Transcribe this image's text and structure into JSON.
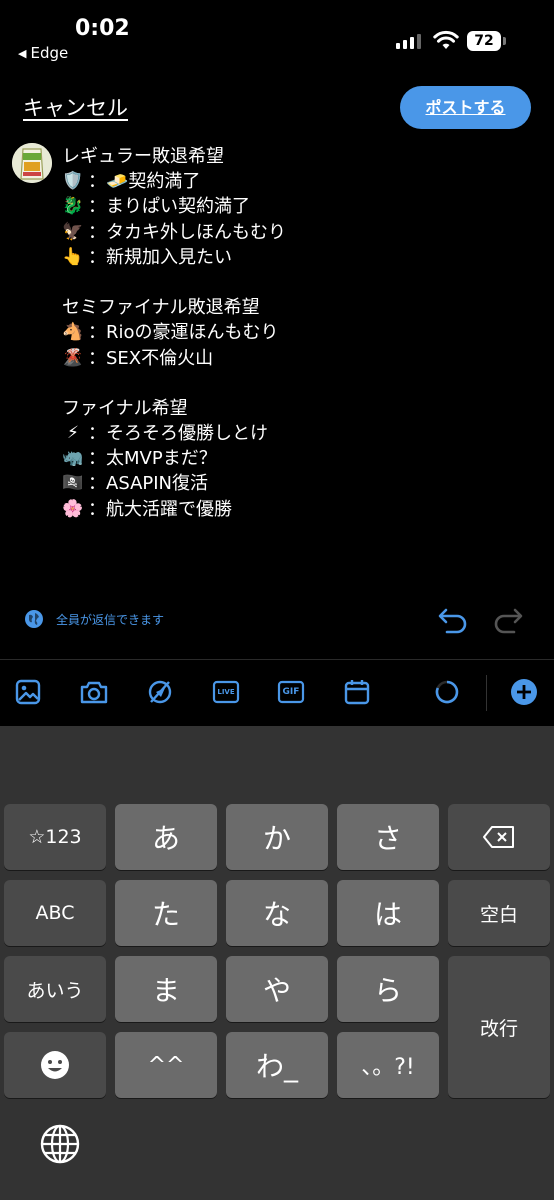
{
  "status_bar": {
    "time": "0:02",
    "back_app": "Edge",
    "battery": "72"
  },
  "header": {
    "cancel_label": "キャンセル",
    "post_label": "ポストする"
  },
  "tweet": {
    "lines": [
      {
        "emoji": "",
        "text": "レギュラー敗退希望"
      },
      {
        "emoji": "🛡️",
        "text": "：🧈契約満了"
      },
      {
        "emoji": "🐉",
        "text": "：まりぱい契約満了"
      },
      {
        "emoji": "🦅",
        "text": "：タカキ外しほんもむり"
      },
      {
        "emoji": "👆",
        "text": "：新規加入見たい"
      },
      {
        "emoji": "",
        "text": ""
      },
      {
        "emoji": "",
        "text": "セミファイナル敗退希望"
      },
      {
        "emoji": "🐴",
        "text": "：Rioの豪運ほんもむり"
      },
      {
        "emoji": "🌋",
        "text": "：SEX不倫火山"
      },
      {
        "emoji": "",
        "text": ""
      },
      {
        "emoji": "",
        "text": "ファイナル希望"
      },
      {
        "emoji": "⚡",
        "text": "：そろそろ優勝しとけ"
      },
      {
        "emoji": "🦏",
        "text": "：太MVPまだ？"
      },
      {
        "emoji": "🏴‍☠️",
        "text": "：ASAPIN復活"
      },
      {
        "emoji": "🌸",
        "text": "：航大活躍で優勝"
      }
    ]
  },
  "reply_setting": {
    "label": "全員が返信できます"
  },
  "toolbar": {
    "icons": [
      "image-icon",
      "camera-icon",
      "no-location-icon",
      "live-icon",
      "gif-icon",
      "schedule-icon",
      "char-count-ring-icon",
      "add-post-icon"
    ],
    "live_label": "LIVE",
    "gif_label": "GIF"
  },
  "keyboard": {
    "keys": {
      "num": "☆123",
      "a": "あ",
      "ka": "か",
      "sa": "さ",
      "abc": "ABC",
      "ta": "た",
      "na": "な",
      "ha": "は",
      "space": "空白",
      "kana": "あいう",
      "ma": "ま",
      "ya": "や",
      "ra": "ら",
      "enter": "改行",
      "dakuten": "^^",
      "wa": "わ_",
      "punct": "、。?!"
    }
  },
  "colors": {
    "accent": "#4a97e8",
    "background": "#000000",
    "keyboard_bg": "#333333",
    "key_main": "#6b6b6b",
    "key_function": "#4a4a4a"
  }
}
